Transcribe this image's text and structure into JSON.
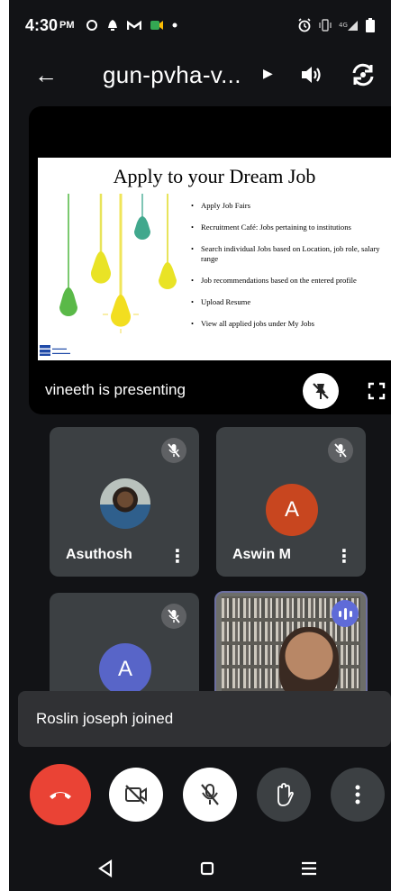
{
  "status_bar": {
    "time": "4:30",
    "ampm": "PM",
    "left_icons": [
      "sync-icon",
      "notification-icon",
      "gmail-icon",
      "meet-icon",
      "dot-icon"
    ],
    "right_icons": [
      "alarm-icon",
      "vibrate-icon",
      "signal-icon",
      "battery-icon"
    ]
  },
  "appbar": {
    "back_glyph": "←",
    "meeting_code": "gun-pvha-v...",
    "caret_glyph": "▶"
  },
  "presentation": {
    "slide_title": "Apply to your Dream Job",
    "slide_bullets": [
      "Apply Job Fairs",
      "Recruitment Café: Jobs pertaining to institutions",
      "Search individual Jobs based on Location, job role, salary range",
      "Job recommendations based on the entered profile",
      "Upload Resume",
      "View all applied jobs under My Jobs"
    ],
    "presenter_text": "vineeth is presenting"
  },
  "participants": [
    {
      "name": "Asuthosh",
      "type": "photo",
      "muted": true
    },
    {
      "name": "Aswin M",
      "type": "letter",
      "letter": "A",
      "color": "#c8461f",
      "muted": true
    },
    {
      "name": "",
      "type": "letter",
      "letter": "A",
      "color": "#5865c8",
      "muted": true
    },
    {
      "name": "",
      "type": "video",
      "speaking": true
    }
  ],
  "toast": {
    "text": "Roslin joseph joined"
  },
  "controls": {
    "end_call_color": "#ea4335",
    "more_glyph": "⋮"
  },
  "colors": {
    "background": "#121316",
    "tile": "#3c4043",
    "speaking_indicator": "#5f6bd8"
  }
}
